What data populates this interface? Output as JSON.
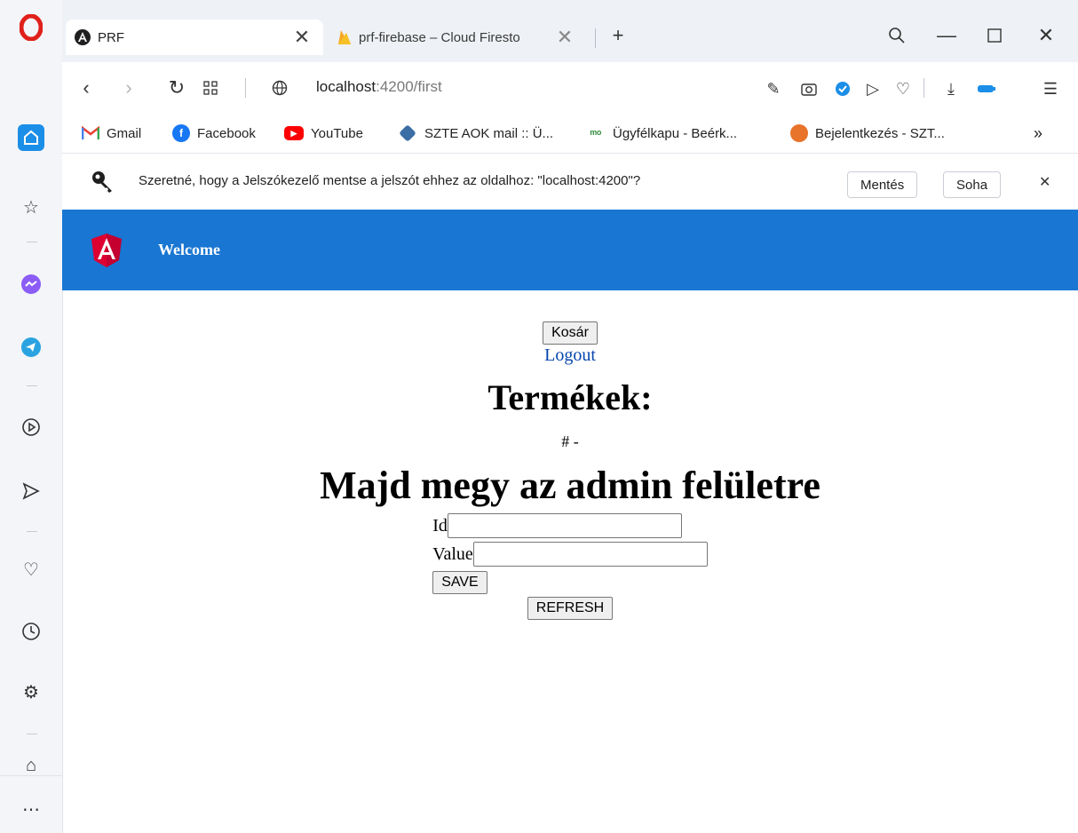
{
  "browser": {
    "tabs": [
      {
        "title": "PRF",
        "active": true
      },
      {
        "title": "prf-firebase – Cloud Firesto",
        "active": false
      }
    ],
    "url": {
      "host": "localhost",
      "path": ":4200/first"
    },
    "bookmarks": [
      {
        "label": "Gmail",
        "icon": "gmail-icon"
      },
      {
        "label": "Facebook",
        "icon": "facebook-icon"
      },
      {
        "label": "YouTube",
        "icon": "youtube-icon"
      },
      {
        "label": "SZTE AOK mail :: Ü...",
        "icon": "mail-icon"
      },
      {
        "label": "Ügyfélkapu - Beérk...",
        "icon": "ugyfelkapu-icon"
      },
      {
        "label": "Bejelentkezés - SZT...",
        "icon": "orange-globe-icon"
      }
    ],
    "password_prompt": {
      "text": "Szeretné, hogy a Jelszókezelő mentse a jelszót ehhez az oldalhoz: \"localhost:4200\"?",
      "save_label": "Mentés",
      "never_label": "Soha"
    }
  },
  "app": {
    "toolbar_title": "Welcome",
    "cart_label": "Kosár",
    "logout_label": "Logout",
    "products_title": "Termékek:",
    "product_item": "# -",
    "admin_title": "Majd megy az admin felületre",
    "form": {
      "id_label": "Id",
      "value_label": "Value",
      "id_value": "",
      "value_value": "",
      "save_label": "SAVE"
    },
    "refresh_label": "REFRESH"
  },
  "colors": {
    "toolbar": "#1976d2",
    "opera_red": "#e0201b",
    "link": "#0645ad"
  }
}
